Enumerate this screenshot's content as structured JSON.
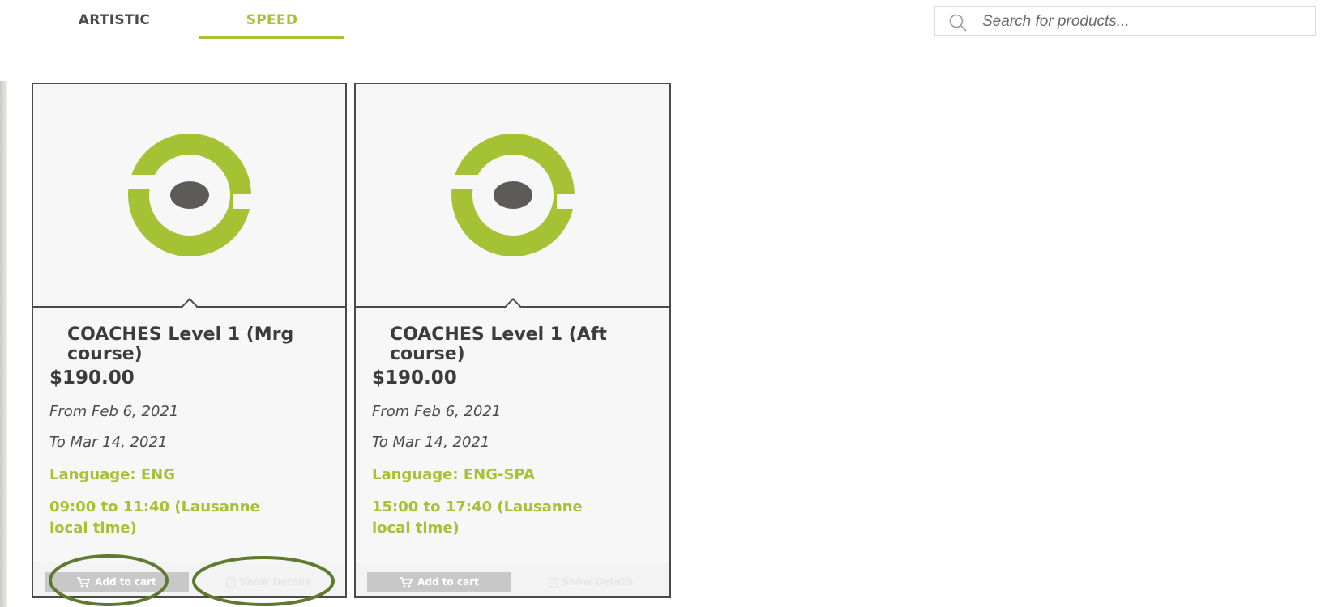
{
  "tabs": [
    {
      "label": "ARTISTIC",
      "active": false
    },
    {
      "label": "SPEED",
      "active": true
    }
  ],
  "search": {
    "placeholder": "Search for products..."
  },
  "colors": {
    "accent": "#a5c234",
    "logo_dot": "#5c5b58",
    "annotation": "#5f7a2e"
  },
  "products": [
    {
      "title": "COACHES Level 1 (Mrg course)",
      "price": "$190.00",
      "from": "From Feb 6, 2021",
      "to": "To Mar 14, 2021",
      "language": "Language: ENG",
      "time": "09:00 to 11:40 (Lausanne local time)",
      "add_to_cart": "Add to cart",
      "show_details": "Show Details"
    },
    {
      "title": "COACHES Level 1 (Aft course)",
      "price": "$190.00",
      "from": "From Feb 6, 2021",
      "to": "To Mar 14, 2021",
      "language": "Language: ENG-SPA",
      "time": "15:00 to 17:40 (Lausanne local time)",
      "add_to_cart": "Add to cart",
      "show_details": "Show Details"
    }
  ],
  "icons": {
    "search": "search-icon",
    "cart": "cart-icon",
    "details": "document-icon",
    "product_logo": "ring-logo"
  }
}
